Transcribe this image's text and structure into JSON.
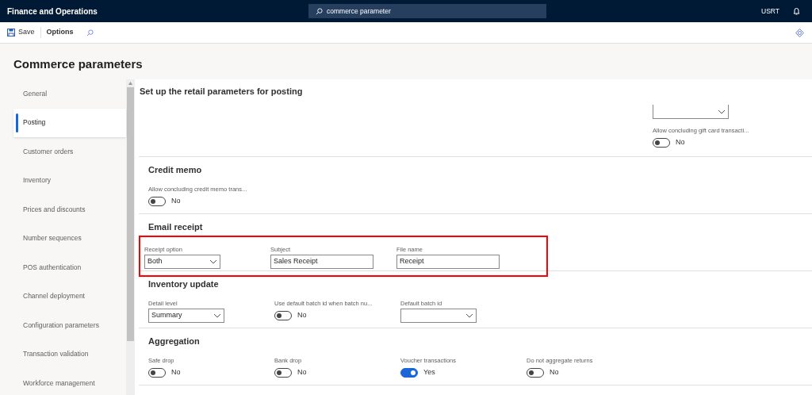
{
  "app_title": "Finance and Operations",
  "search": {
    "value": "commerce parameter"
  },
  "user": "USRT",
  "toolbar": {
    "save": "Save",
    "options": "Options"
  },
  "page_title": "Commerce parameters",
  "sidebar": {
    "items": [
      {
        "label": "General",
        "selected": false
      },
      {
        "label": "Posting",
        "selected": true
      },
      {
        "label": "Customer orders",
        "selected": false
      },
      {
        "label": "Inventory",
        "selected": false
      },
      {
        "label": "Prices and discounts",
        "selected": false
      },
      {
        "label": "Number sequences",
        "selected": false
      },
      {
        "label": "POS authentication",
        "selected": false
      },
      {
        "label": "Channel deployment",
        "selected": false
      },
      {
        "label": "Configuration parameters",
        "selected": false
      },
      {
        "label": "Transaction validation",
        "selected": false
      },
      {
        "label": "Workforce management",
        "selected": false
      }
    ]
  },
  "content_heading": "Set up the retail parameters for posting",
  "sections": [
    {
      "fields": [
        {
          "kind": "dropdown"
        },
        {
          "kind": "toggle",
          "label": "Allow concluding gift card transacti...",
          "on": false,
          "value": "No"
        }
      ]
    },
    {
      "title": "Credit memo",
      "fields": [
        {
          "kind": "toggle",
          "label": "Allow concluding credit memo trans...",
          "on": false,
          "value": "No"
        }
      ]
    },
    {
      "title": "Email receipt",
      "highlighted": true,
      "fields": [
        {
          "kind": "dropdown",
          "label": "Receipt option",
          "value": "Both"
        },
        {
          "kind": "text",
          "label": "Subject",
          "value": "Sales Receipt"
        },
        {
          "kind": "text",
          "label": "File name",
          "value": "Receipt"
        }
      ]
    },
    {
      "title": "Inventory update",
      "fields": [
        {
          "kind": "dropdown",
          "label": "Detail level",
          "value": "Summary"
        },
        {
          "kind": "toggle",
          "label": "Use default batch id when batch nu...",
          "on": false,
          "value": "No"
        },
        {
          "kind": "dropdown",
          "label": "Default batch id"
        }
      ]
    },
    {
      "title": "Aggregation",
      "fields": [
        {
          "kind": "toggle",
          "label": "Safe drop",
          "on": false,
          "value": "No"
        },
        {
          "kind": "toggle",
          "label": "Bank drop",
          "on": false,
          "value": "No"
        },
        {
          "kind": "toggle",
          "label": "Voucher transactions",
          "on": true,
          "value": "Yes"
        },
        {
          "kind": "toggle",
          "label": "Do not aggregate returns",
          "on": false,
          "value": "No"
        }
      ]
    }
  ]
}
